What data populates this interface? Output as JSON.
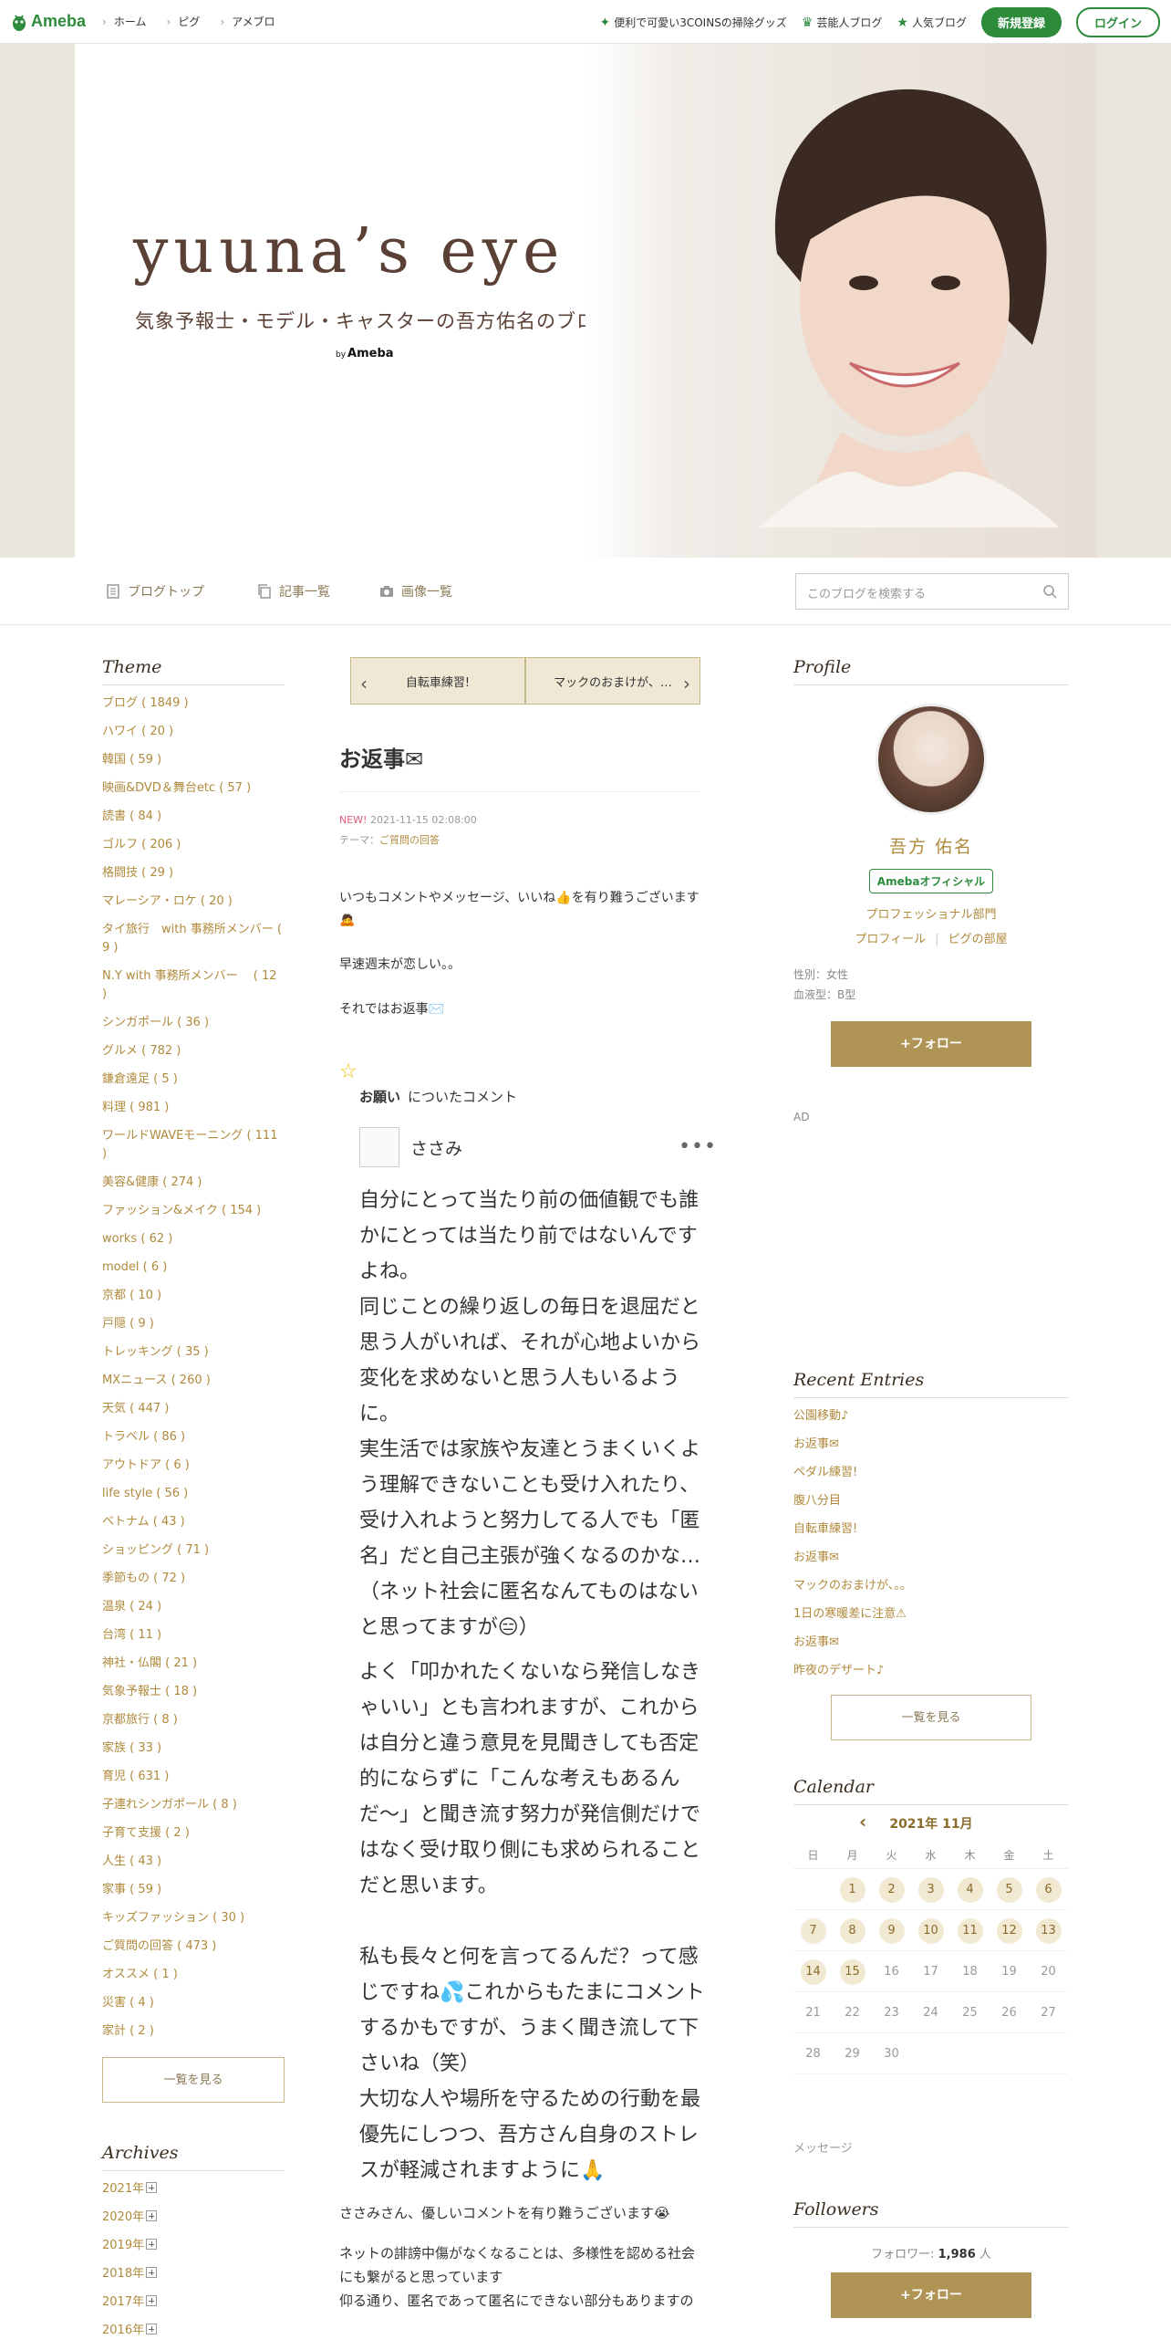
{
  "topbar": {
    "logo": "Ameba",
    "nav": [
      "ホーム",
      "ピグ",
      "アメブロ"
    ],
    "links": [
      {
        "icon": "sparkle-icon",
        "label": "便利で可愛い3COINSの掃除グッズ"
      },
      {
        "icon": "crown-icon",
        "label": "芸能人ブログ"
      },
      {
        "icon": "star-icon",
        "label": "人気ブログ"
      }
    ],
    "register": "新規登録",
    "login": "ログイン"
  },
  "header": {
    "title": "yuuna’s eye",
    "subtitle": "気象予報士・モデル・キャスターの吾方佑名のブログ",
    "by": "by",
    "by_brand": "Ameba"
  },
  "blognav": {
    "items": [
      "ブログトップ",
      "記事一覧",
      "画像一覧"
    ],
    "search_placeholder": "このブログを検索する"
  },
  "left": {
    "theme_title": "Theme",
    "themes": [
      "ブログ ( 1849 )",
      "ハワイ ( 20 )",
      "韓国 ( 59 )",
      "映画&DVD＆舞台etc ( 57 )",
      "読書 ( 84 )",
      "ゴルフ ( 206 )",
      "格闘技 ( 29 )",
      "マレーシア・ロケ ( 20 )",
      "タイ旅行　with 事務所メンバー ( 9 )",
      "N.Y with 事務所メンバー　 ( 12 )",
      "シンガポール ( 36 )",
      "グルメ ( 782 )",
      "鎌倉遠足 ( 5 )",
      "料理 ( 981 )",
      "ワールドWAVEモーニング ( 111 )",
      "美容&健康 ( 274 )",
      "ファッション&メイク ( 154 )",
      "works ( 62 )",
      "model ( 6 )",
      "京都 ( 10 )",
      "戸隠 ( 9 )",
      "トレッキング ( 35 )",
      "MXニュース ( 260 )",
      "天気 ( 447 )",
      "トラベル ( 86 )",
      "アウトドア ( 6 )",
      "life style ( 56 )",
      "ベトナム ( 43 )",
      "ショッピング ( 71 )",
      "季節もの ( 72 )",
      "温泉 ( 24 )",
      "台湾 ( 11 )",
      "神社・仏閣 ( 21 )",
      "気象予報士 ( 18 )",
      "京都旅行 ( 8 )",
      "家族 ( 33 )",
      "育児 ( 631 )",
      "子連れシンガポール ( 8 )",
      "子育て支援 ( 2 )",
      "人生 ( 43 )",
      "家事 ( 59 )",
      "キッズファッション ( 30 )",
      "ご質問の回答 ( 473 )",
      "オススメ ( 1 )",
      "災害 ( 4 )",
      "家計 ( 2 )"
    ],
    "more": "一覧を見る",
    "archive_title": "Archives",
    "archives": [
      "2021年",
      "2020年",
      "2019年",
      "2018年",
      "2017年",
      "2016年"
    ]
  },
  "post": {
    "prev": "自転車練習!",
    "next": "マックのおまけが、…",
    "title": "お返事✉",
    "new_badge": "NEW!",
    "date": "2021-11-15 02:08:00",
    "theme_label": "テーマ：",
    "theme": "ご質問の回答",
    "paragraphs": [
      "いつもコメントやメッセージ、いいね👍を有り難うございます🙇",
      "早速週末が恋しい。。",
      "それではお返事✉️"
    ],
    "comment_label": "お願い",
    "comment_suffix": "についたコメント",
    "commenter": "ささみ",
    "comment_lines": [
      "自分にとって当たり前の価値観でも誰かにとっては当たり前ではないんですよね。",
      "同じことの繰り返しの毎日を退屈だと思う人がいれば、それが心地よいから変化を求めないと思う人もいるように。",
      "実生活では家族や友達とうまくいくよう理解できないことも受け入れたり、受け入れようと努力してる人でも「匿名」だと自己主張が強くなるのかな…（ネット社会に匿名なんてものはないと思ってますが😑）",
      "よく「叩かれたくないなら発信しなきゃいい」とも言われますが、これからは自分と違う意見を見聞きしても否定的にならずに「こんな考えもあるんだ〜」と聞き流す努力が発信側だけではなく受け取り側にも求められることだと思います。",
      "",
      "私も長々と何を言ってるんだ？って感じですね💦これからもたまにコメントするかもですが、うまく聞き流して下さいね（笑）",
      "大切な人や場所を守るための行動を最優先にしつつ、吾方さん自身のストレスが軽減されますように🙏"
    ],
    "reply_lines": [
      "ささみさん、優しいコメントを有り難うございます😭",
      "ネットの誹謗中傷がなくなることは、多様性を認める社会にも繋がると思っています",
      "仰る通り、匿名であって匿名にできない部分もありますの"
    ]
  },
  "right": {
    "profile_title": "Profile",
    "name": "吾方 佑名",
    "official": "Amebaオフィシャル",
    "category": "プロフェッショナル部門",
    "profile_link": "プロフィール",
    "pig_link": "ピグの部屋",
    "gender": "性別：女性",
    "blood": "血液型：B型",
    "follow": "+フォロー",
    "ad": "AD",
    "recent_title": "Recent Entries",
    "recent": [
      "公園移動♪",
      "お返事✉",
      "ペダル練習!",
      "腹八分目",
      "自転車練習!",
      "お返事✉",
      "マックのおまけが、。。",
      "1日の寒暖差に注意⚠",
      "お返事✉",
      "昨夜のデザート♪"
    ],
    "more": "一覧を見る",
    "calendar_title": "Calendar",
    "calendar_month": "2021年 11月",
    "dow": [
      "日",
      "月",
      "火",
      "水",
      "木",
      "金",
      "土"
    ],
    "days": [
      "",
      "1",
      "2",
      "3",
      "4",
      "5",
      "6",
      "7",
      "8",
      "9",
      "10",
      "11",
      "12",
      "13",
      "14",
      "15",
      "16",
      "17",
      "18",
      "19",
      "20",
      "21",
      "22",
      "23",
      "24",
      "25",
      "26",
      "27",
      "28",
      "29",
      "30",
      "",
      "",
      "",
      ""
    ],
    "days_with_posts": [
      "1",
      "2",
      "3",
      "4",
      "5",
      "6",
      "7",
      "8",
      "9",
      "10",
      "11",
      "12",
      "13",
      "14",
      "15"
    ],
    "message": "メッセージ",
    "followers_title": "Followers",
    "followers_label": "フォロワー:",
    "followers_count": "1,986",
    "followers_unit": "人",
    "follow2": "+フォロー"
  }
}
